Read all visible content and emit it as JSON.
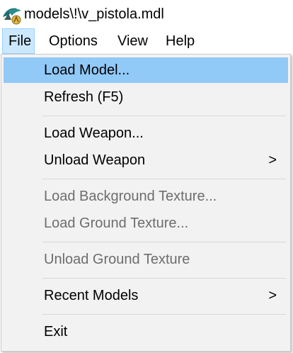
{
  "window": {
    "title": "models\\!\\v_pistola.mdl",
    "icon": "half-life-lambda-icon"
  },
  "menubar": {
    "items": [
      {
        "label": "File",
        "active": true
      },
      {
        "label": "Options"
      },
      {
        "label": "View"
      },
      {
        "label": "Help"
      }
    ]
  },
  "file_menu": {
    "items": [
      {
        "label": "Load Model...",
        "state": "highlighted"
      },
      {
        "label": "Refresh (F5)"
      },
      {
        "label": "Load Weapon..."
      },
      {
        "label": "Unload Weapon",
        "submenu": true
      },
      {
        "label": "Load Background Texture...",
        "state": "disabled"
      },
      {
        "label": "Load Ground Texture...",
        "state": "disabled"
      },
      {
        "label": "Unload Ground Texture",
        "state": "disabled"
      },
      {
        "label": "Recent Models",
        "submenu": true
      },
      {
        "label": "Exit"
      }
    ],
    "submenu_arrow": ">"
  },
  "colors": {
    "highlight": "#91c9f7",
    "menubar_active": "#cce8ff",
    "disabled_text": "#6d6d6d"
  }
}
